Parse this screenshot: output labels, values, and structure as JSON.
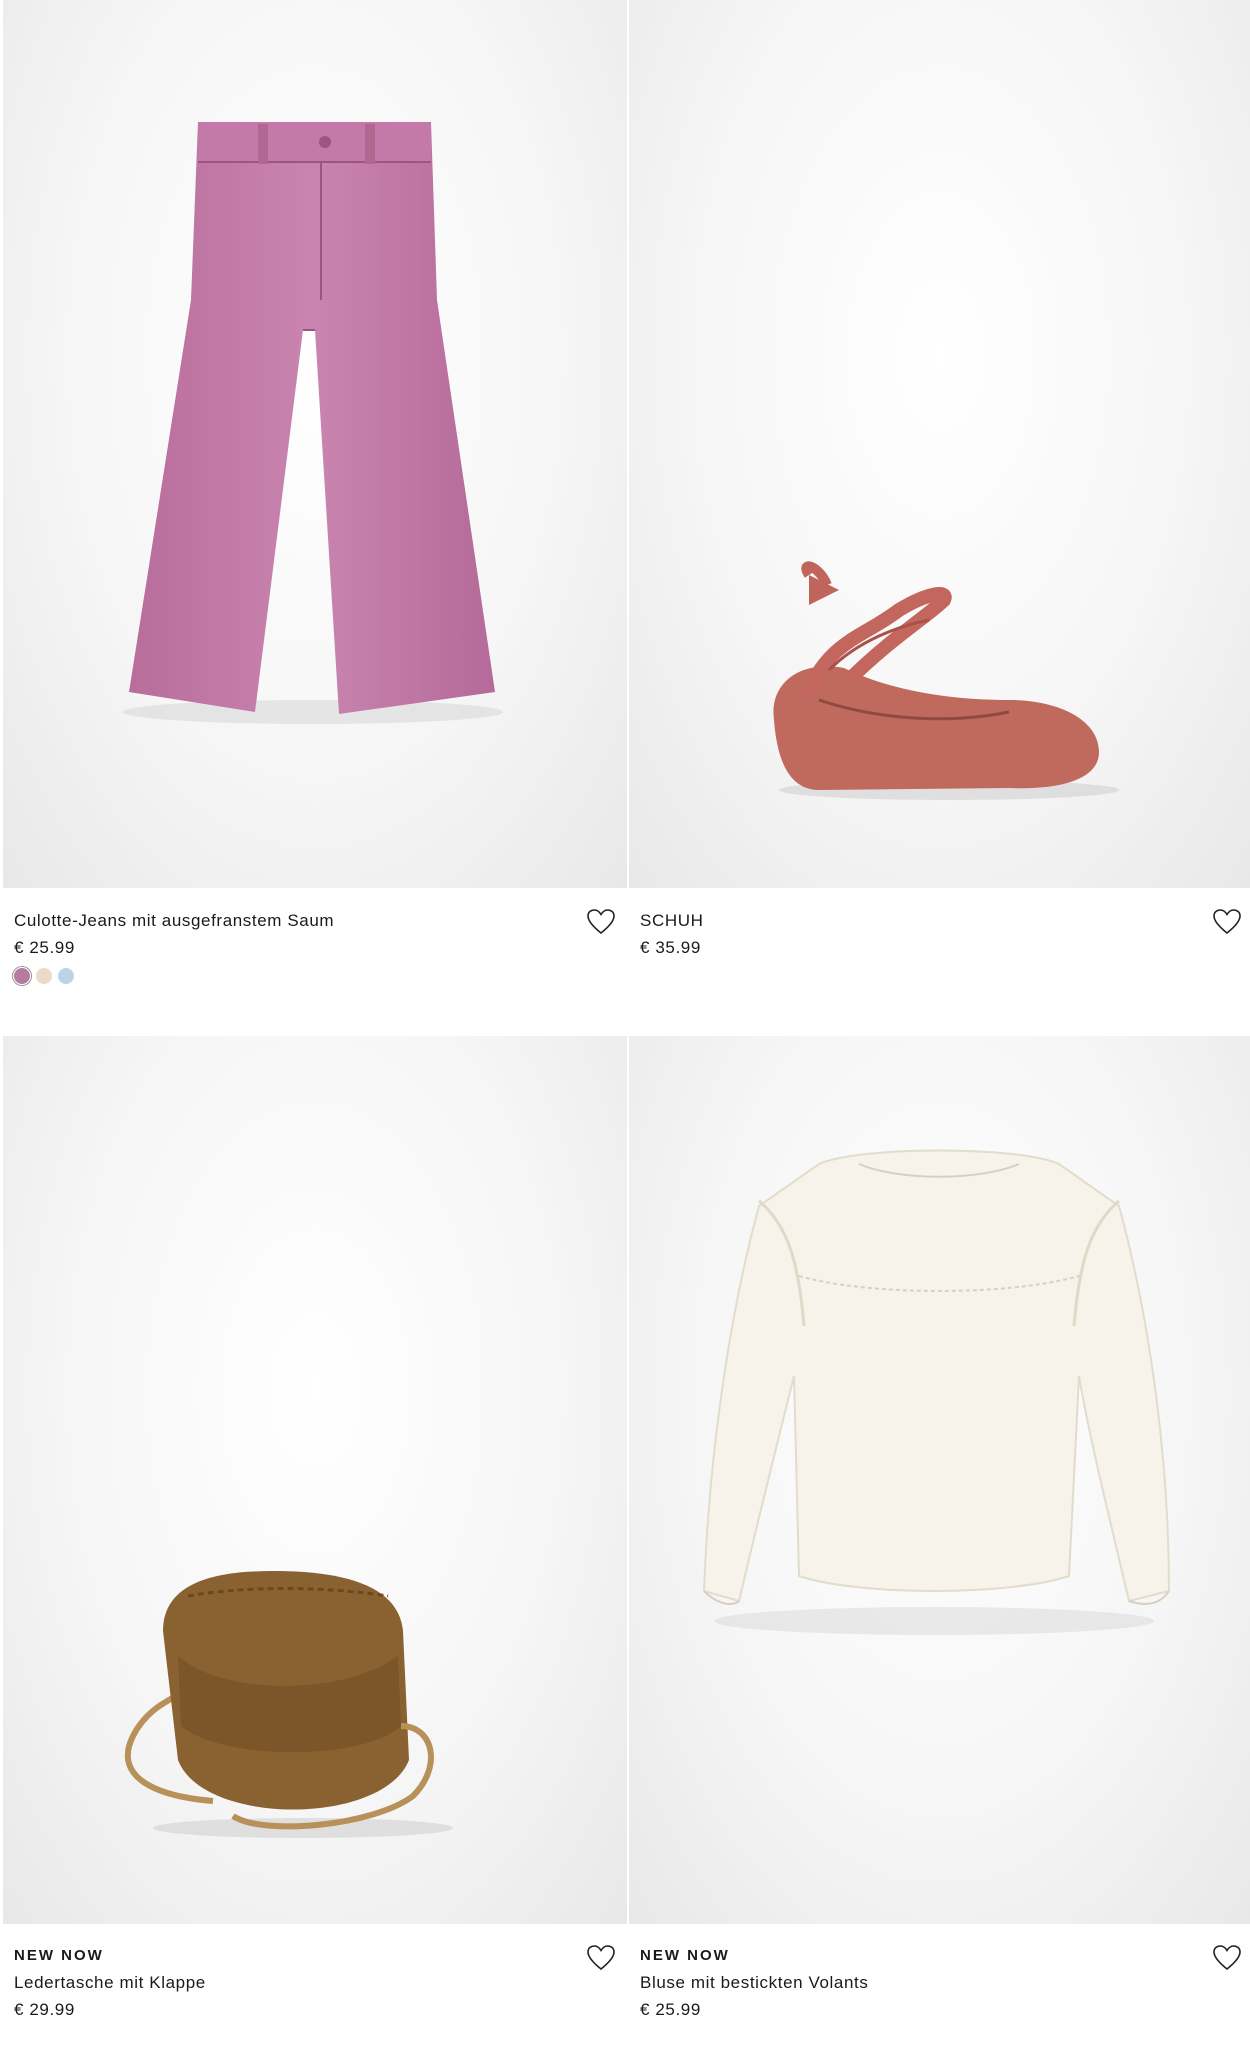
{
  "products": [
    {
      "badge": "",
      "name": "Culotte-Jeans mit ausgefranstem Saum",
      "price": "€ 25.99",
      "image_icon": "pink-culotte-jeans-image",
      "swatches": [
        "#b77aa3",
        "#e8dcc6",
        "#bcd3ea"
      ]
    },
    {
      "badge": "",
      "name": "SCHUH",
      "price": "€ 35.99",
      "image_icon": "ballerina-shoe-image",
      "swatches": []
    },
    {
      "badge": "NEW NOW",
      "name": "Ledertasche mit Klappe",
      "price": "€ 29.99",
      "image_icon": "suede-crossbody-bag-image",
      "swatches": []
    },
    {
      "badge": "NEW NOW",
      "name": "Bluse mit bestickten Volants",
      "price": "€ 25.99",
      "image_icon": "white-ruffle-blouse-image",
      "swatches": []
    }
  ],
  "colors": {
    "text": "#1a1a1a",
    "pants": "#c27aa6",
    "shoe": "#c06a5e",
    "bag": "#8a6232",
    "blouse": "#f7f3ea"
  },
  "icons": {
    "favorite": "heart-outline-icon"
  }
}
